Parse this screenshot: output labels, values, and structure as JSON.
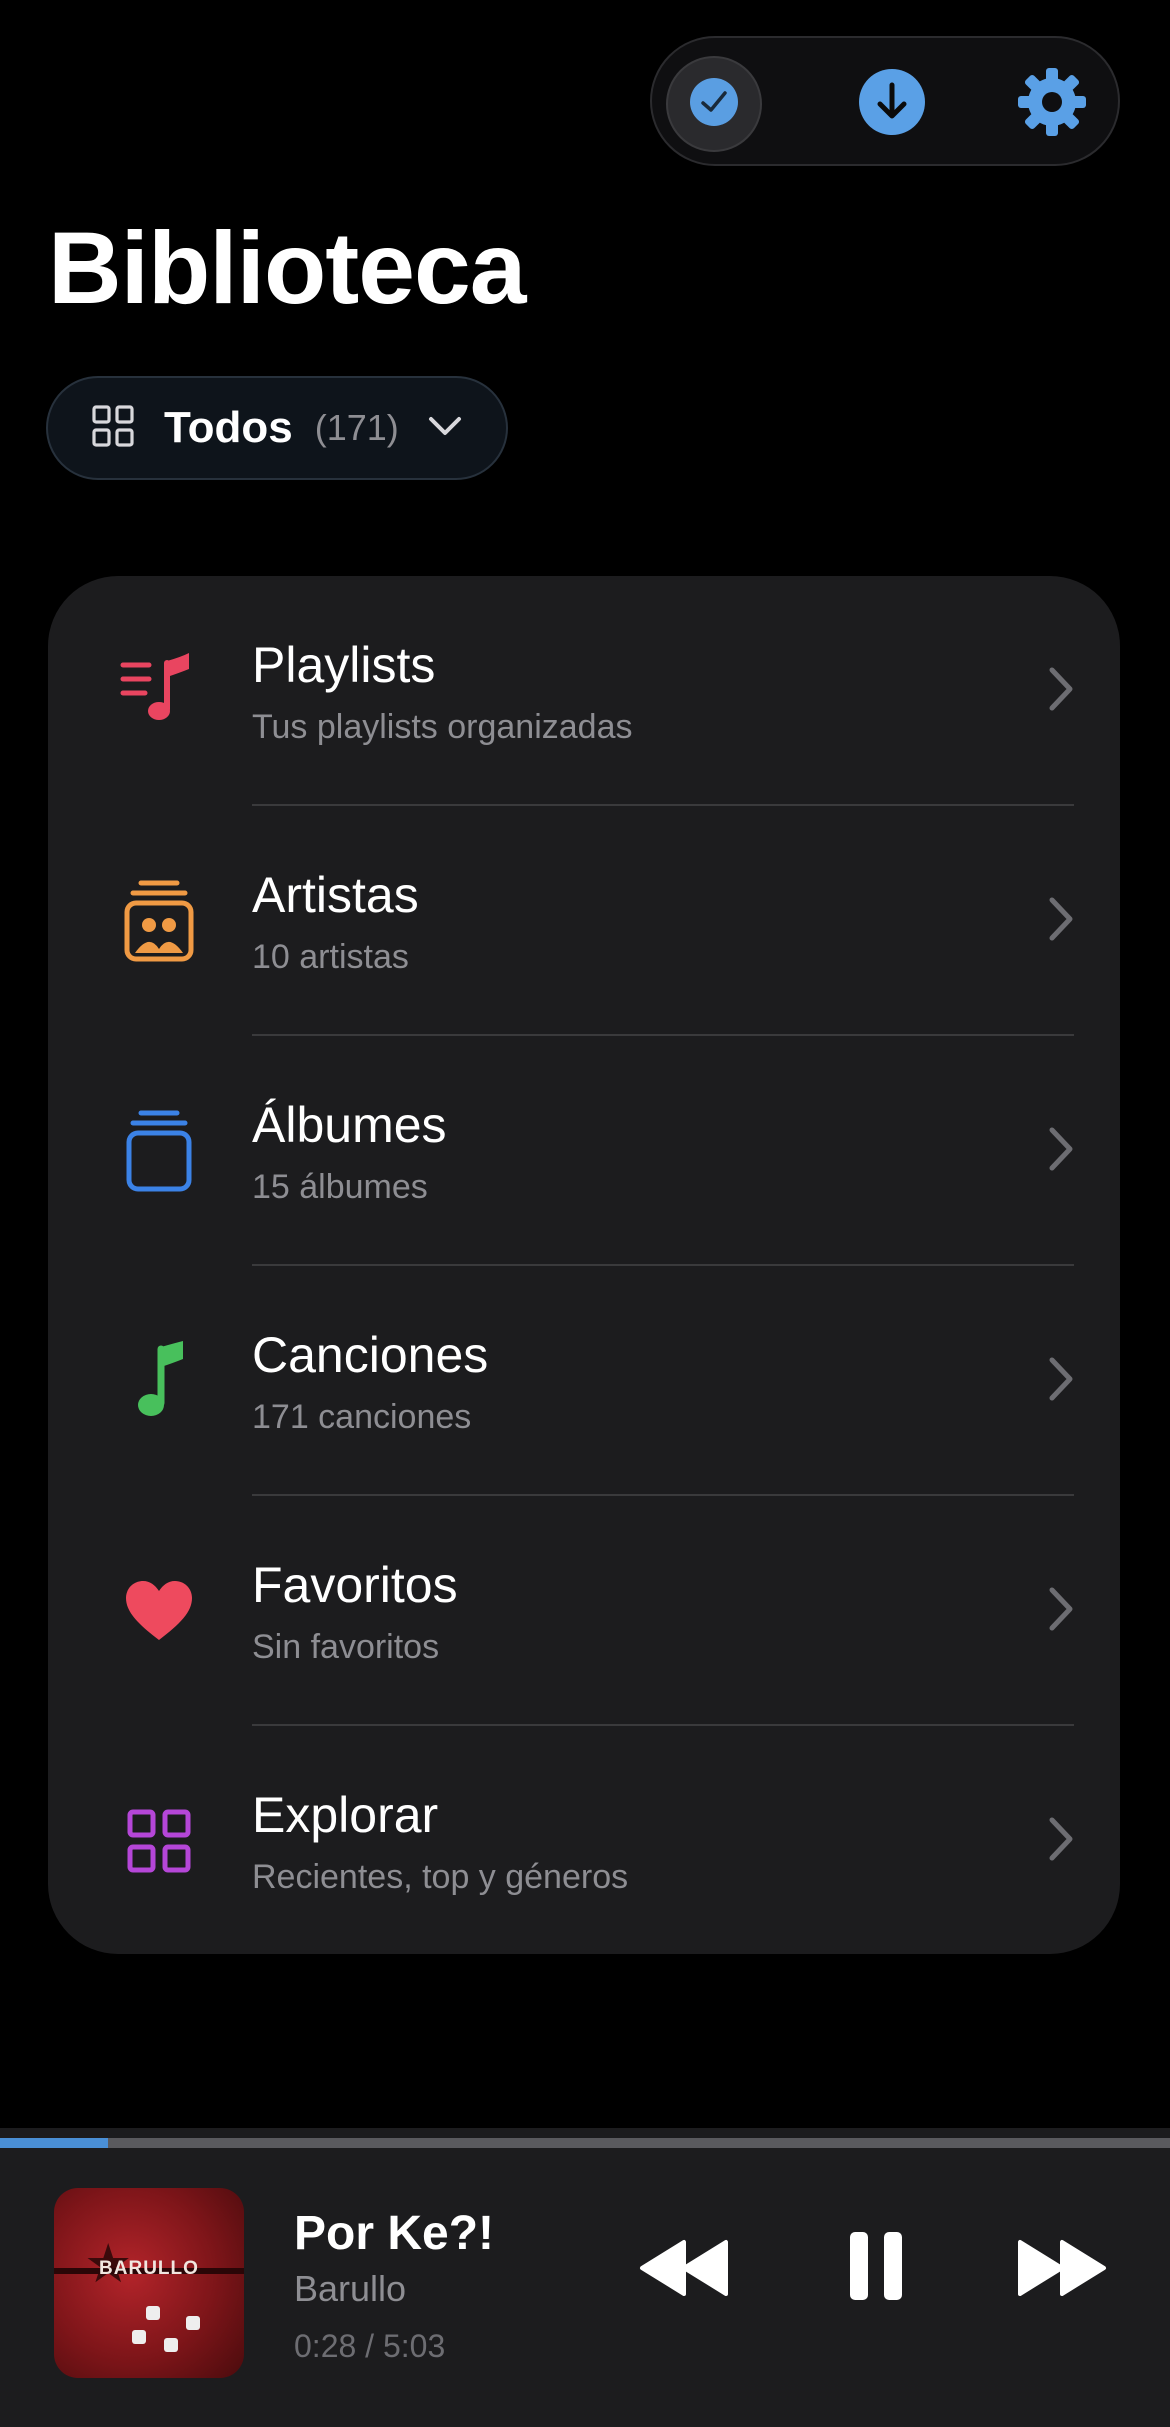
{
  "header": {
    "title": "Biblioteca",
    "toolbar": [
      {
        "icon": "checkmark-icon",
        "label": ""
      },
      {
        "icon": "download-icon",
        "label": ""
      },
      {
        "icon": "gear-icon",
        "label": ""
      }
    ]
  },
  "filter": {
    "icon": "grid-icon",
    "label": "Todos",
    "count": "(171)"
  },
  "library": {
    "items": [
      {
        "title": "Playlists",
        "subtitle": "Tus playlists organizadas",
        "icon": "playlist-icon",
        "color": "#e94560"
      },
      {
        "title": "Artistas",
        "subtitle": "10 artistas",
        "icon": "artist-icon",
        "color": "#f09a44"
      },
      {
        "title": "Álbumes",
        "subtitle": "15 álbumes",
        "icon": "album-icon",
        "color": "#3b82e6"
      },
      {
        "title": "Canciones",
        "subtitle": "171 canciones",
        "icon": "music-note-icon",
        "color": "#48c05c"
      },
      {
        "title": "Favoritos",
        "subtitle": "Sin favoritos",
        "icon": "heart-icon",
        "color": "#ee4a5e"
      },
      {
        "title": "Explorar",
        "subtitle": "Recientes, top y géneros",
        "icon": "grid-icon",
        "color": "#b546d8"
      }
    ]
  },
  "player": {
    "title": "Por Ke?!",
    "artist": "Barullo",
    "time": "0:28 / 5:03",
    "progress": 0.092,
    "cover_text": "BARULLO",
    "accent": "#4a8fd6"
  },
  "colors": {
    "background": "#000000",
    "card": "#1c1c1e",
    "secondary_text": "#8e8e93",
    "accent": "#5aa0e6"
  }
}
